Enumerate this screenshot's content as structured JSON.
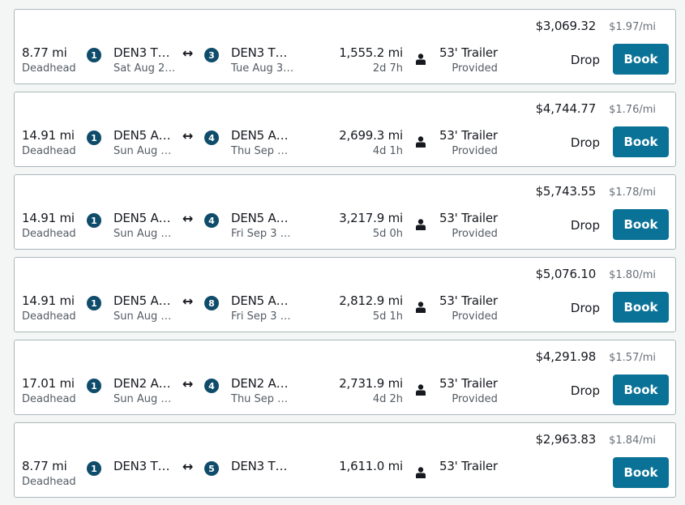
{
  "loads": [
    {
      "price": "$3,069.32",
      "rate": "$1.97/mi",
      "deadhead": "8.77 mi",
      "deadhead_label": "Deadhead",
      "origin_stop": "1",
      "origin_name": "DEN3 T…",
      "origin_date": "Sat Aug 2…",
      "dest_stop": "3",
      "dest_name": "DEN3 T…",
      "dest_date": "Tue Aug 3…",
      "distance": "1,555.2 mi",
      "duration": "2d 7h",
      "trailer": "53' Trailer",
      "trailer_status": "Provided",
      "type": "Drop",
      "book_label": "Book"
    },
    {
      "price": "$4,744.77",
      "rate": "$1.76/mi",
      "deadhead": "14.91 mi",
      "deadhead_label": "Deadhead",
      "origin_stop": "1",
      "origin_name": "DEN5 A…",
      "origin_date": "Sun Aug …",
      "dest_stop": "4",
      "dest_name": "DEN5 A…",
      "dest_date": "Thu Sep …",
      "distance": "2,699.3 mi",
      "duration": "4d 1h",
      "trailer": "53' Trailer",
      "trailer_status": "Provided",
      "type": "Drop",
      "book_label": "Book"
    },
    {
      "price": "$5,743.55",
      "rate": "$1.78/mi",
      "deadhead": "14.91 mi",
      "deadhead_label": "Deadhead",
      "origin_stop": "1",
      "origin_name": "DEN5 A…",
      "origin_date": "Sun Aug …",
      "dest_stop": "4",
      "dest_name": "DEN5 A…",
      "dest_date": "Fri Sep 3 …",
      "distance": "3,217.9 mi",
      "duration": "5d 0h",
      "trailer": "53' Trailer",
      "trailer_status": "Provided",
      "type": "Drop",
      "book_label": "Book"
    },
    {
      "price": "$5,076.10",
      "rate": "$1.80/mi",
      "deadhead": "14.91 mi",
      "deadhead_label": "Deadhead",
      "origin_stop": "1",
      "origin_name": "DEN5 A…",
      "origin_date": "Sun Aug …",
      "dest_stop": "8",
      "dest_name": "DEN5 A…",
      "dest_date": "Fri Sep 3 …",
      "distance": "2,812.9 mi",
      "duration": "5d 1h",
      "trailer": "53' Trailer",
      "trailer_status": "Provided",
      "type": "Drop",
      "book_label": "Book"
    },
    {
      "price": "$4,291.98",
      "rate": "$1.57/mi",
      "deadhead": "17.01 mi",
      "deadhead_label": "Deadhead",
      "origin_stop": "1",
      "origin_name": "DEN2 A…",
      "origin_date": "Sun Aug …",
      "dest_stop": "4",
      "dest_name": "DEN2 A…",
      "dest_date": "Thu Sep …",
      "distance": "2,731.9 mi",
      "duration": "4d 2h",
      "trailer": "53' Trailer",
      "trailer_status": "Provided",
      "type": "Drop",
      "book_label": "Book"
    },
    {
      "price": "$2,963.83",
      "rate": "$1.84/mi",
      "deadhead": "8.77 mi",
      "deadhead_label": "Deadhead",
      "origin_stop": "1",
      "origin_name": "DEN3 T…",
      "origin_date": "",
      "dest_stop": "5",
      "dest_name": "DEN3 T…",
      "dest_date": "",
      "distance": "1,611.0 mi",
      "duration": "",
      "trailer": "53' Trailer",
      "trailer_status": "",
      "type": "",
      "book_label": "Book"
    }
  ],
  "icons": {
    "route_arrow": "↔",
    "driver": "person-icon"
  }
}
